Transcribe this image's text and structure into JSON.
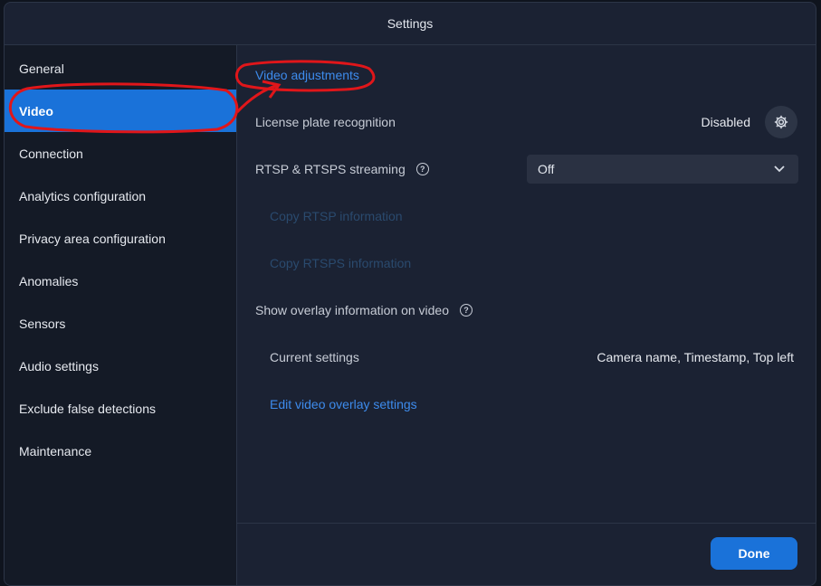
{
  "dialog": {
    "title": "Settings"
  },
  "sidebar": {
    "items": [
      {
        "label": "General"
      },
      {
        "label": "Video"
      },
      {
        "label": "Connection"
      },
      {
        "label": "Analytics configuration"
      },
      {
        "label": "Privacy area configuration"
      },
      {
        "label": "Anomalies"
      },
      {
        "label": "Sensors"
      },
      {
        "label": "Audio settings"
      },
      {
        "label": "Exclude false detections"
      },
      {
        "label": "Maintenance"
      }
    ],
    "active_index": 1
  },
  "content": {
    "video_adjustments_link": "Video adjustments",
    "license_plate": {
      "label": "License plate recognition",
      "status": "Disabled"
    },
    "rtsp": {
      "label": "RTSP & RTSPS streaming",
      "selected": "Off"
    },
    "copy_rtsp": "Copy RTSP information",
    "copy_rtsps": "Copy RTSPS information",
    "overlay": {
      "label": "Show overlay information on video",
      "current_label": "Current settings",
      "current_value": "Camera name, Timestamp, Top left",
      "edit_link": "Edit video overlay settings"
    }
  },
  "footer": {
    "done_label": "Done"
  },
  "colors": {
    "accent": "#1a72d9",
    "link": "#3d8bec",
    "annotation": "#e0161a"
  }
}
